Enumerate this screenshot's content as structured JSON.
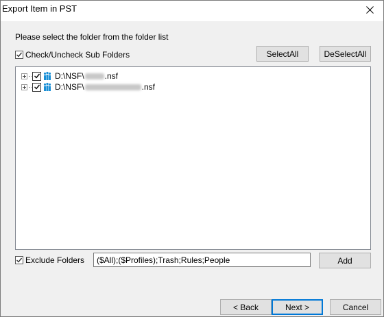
{
  "window": {
    "title": "Export Item in PST"
  },
  "instruction": "Please select the folder from the folder list",
  "subfolders": {
    "label": "Check/Uncheck Sub Folders",
    "checked": true
  },
  "buttons": {
    "select_all": "SelectAll",
    "deselect_all": "DeSelectAll",
    "add": "Add",
    "back": "< Back",
    "next": "Next >",
    "cancel": "Cancel"
  },
  "tree": {
    "items": [
      {
        "prefix": "D:\\NSF\\",
        "suffix": ".nsf",
        "checked": true
      },
      {
        "prefix": "D:\\NSF\\",
        "suffix": ".nsf",
        "checked": true
      }
    ]
  },
  "exclude": {
    "label": "Exclude Folders",
    "checked": true,
    "value": "($All);($Profiles);Trash;Rules;People"
  },
  "colors": {
    "accent": "#0078d7",
    "dialog_bg": "#f0f0f0",
    "notes_icon": "#1a8fd6"
  },
  "icons": {
    "close": "close-icon",
    "tree_item": "notes-database-icon",
    "check": "checkmark-icon"
  }
}
